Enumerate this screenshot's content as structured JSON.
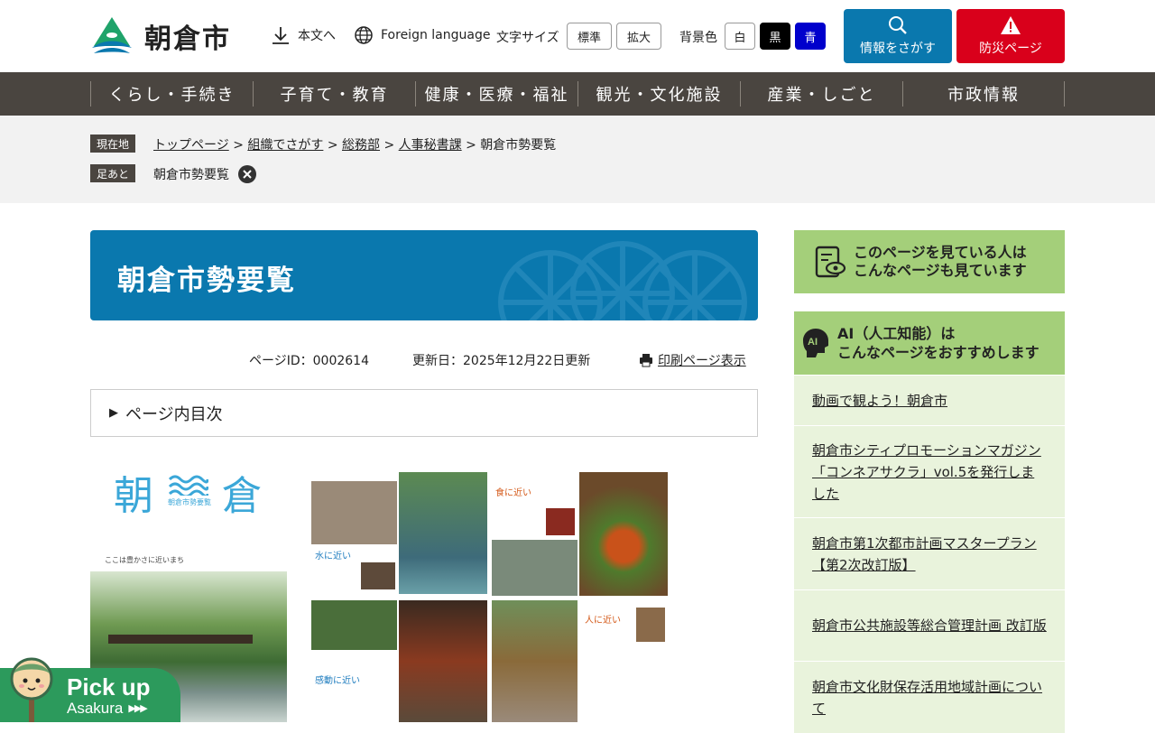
{
  "header": {
    "logo_text": "朝倉市",
    "skip_link": "本文へ",
    "foreign_language": "Foreign language",
    "font_size_label": "文字サイズ",
    "font_standard": "標準",
    "font_large": "拡大",
    "bg_label": "背景色",
    "bg_white": "白",
    "bg_black": "黒",
    "bg_blue": "青",
    "search_button": "情報をさがす",
    "disaster_button": "防災ページ"
  },
  "nav": {
    "items": [
      "くらし・手続き",
      "子育て・教育",
      "健康・医療・福祉",
      "観光・文化施設",
      "産業・しごと",
      "市政情報"
    ]
  },
  "breadcrumb": {
    "current_tag": "現在地",
    "links": [
      "トップページ",
      "組織でさがす",
      "総務部",
      "人事秘書課"
    ],
    "current": "朝倉市勢要覧",
    "separator": ">",
    "history_tag": "足あと",
    "history_item": "朝倉市勢要覧"
  },
  "page": {
    "title": "朝倉市勢要覧",
    "page_id": "ページID：0002614",
    "updated": "更新日：2025年12月22日更新",
    "print_link": "印刷ページ表示",
    "toc_label": "ページ内目次"
  },
  "images": {
    "cover_title_left": "朝",
    "cover_title_right": "倉",
    "cover_subtitle": "朝倉市勢要覧",
    "cover_caption": "ここは豊かさに近いまち",
    "spread_label_1": "水に近い",
    "spread_label_2": "食に近い",
    "spread_label_3": "感動に近い",
    "spread_label_4": "人に近い"
  },
  "sidebar": {
    "related_heading_1": "このページを見ている人は",
    "related_heading_2": "こんなページも見ています",
    "ai_badge": "AI",
    "ai_heading_1": "AI（人工知能）は",
    "ai_heading_2": "こんなページをおすすめします",
    "ai_items": [
      "動画で観よう！朝倉市",
      "朝倉市シティプロモーションマガジン「コンネアサクラ」vol.5を発行しました",
      "朝倉市第1次都市計画マスタープラン【第2次改訂版】",
      "朝倉市公共施設等総合管理計画 改訂版",
      "朝倉市文化財保存活用地域計画について"
    ]
  },
  "pickup": {
    "title": "Pick up",
    "subtitle": "Asakura",
    "arrows": "▶▶▶"
  },
  "colors": {
    "nav_bg": "#4a4540",
    "title_blue": "#0a78ae",
    "search_blue": "#0a78ae",
    "disaster_red": "#d9001b",
    "side_green": "#a4cf7a",
    "side_list": "#e9f3dc",
    "pickup_green": "#2c9a5c"
  }
}
